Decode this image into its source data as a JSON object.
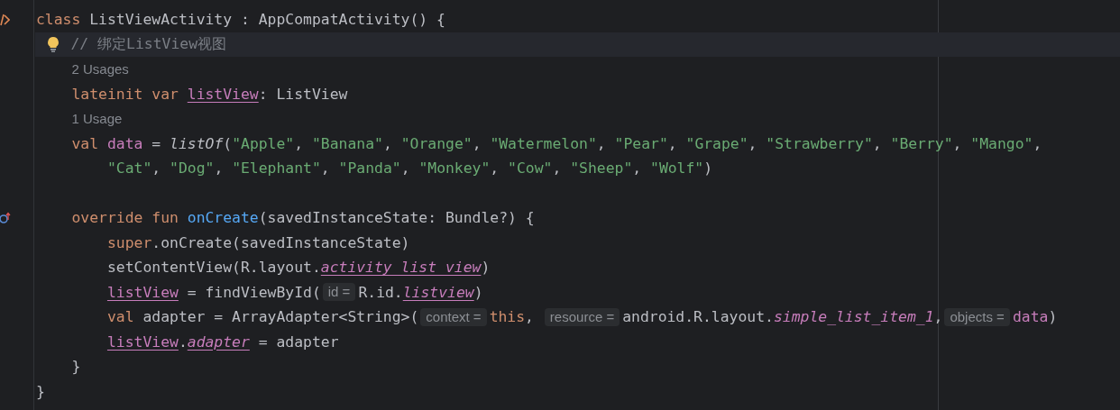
{
  "editor": {
    "lines": [
      {
        "class_marker": true,
        "tokens": [
          {
            "kind": "keyword",
            "text": "class"
          },
          {
            "kind": "text",
            "text": " ListViewActivity : AppCompatActivity() {"
          }
        ],
        "children": [
          {
            "current": true,
            "intention": true,
            "tokens": [
              {
                "kind": "comment",
                "text": "// 绑定ListView视图"
              }
            ]
          },
          {
            "tokens": [
              {
                "kind": "usage",
                "text": "2 Usages"
              }
            ]
          },
          {
            "tokens": [
              {
                "kind": "keyword",
                "text": "lateinit var "
              },
              {
                "kind": "prop-link",
                "text": "listView"
              },
              {
                "kind": "text",
                "text": ": ListView"
              }
            ]
          },
          {
            "tokens": [
              {
                "kind": "usage",
                "text": "1 Usage"
              }
            ]
          },
          {
            "tokens": [
              {
                "kind": "keyword",
                "text": "val "
              },
              {
                "kind": "prop",
                "text": "data"
              },
              {
                "kind": "text",
                "text": " = "
              },
              {
                "kind": "call",
                "text": "listOf"
              },
              {
                "kind": "text",
                "text": "("
              },
              {
                "kind": "string",
                "text": "\"Apple\""
              },
              {
                "kind": "text",
                "text": ", "
              },
              {
                "kind": "string",
                "text": "\"Banana\""
              },
              {
                "kind": "text",
                "text": ", "
              },
              {
                "kind": "string",
                "text": "\"Orange\""
              },
              {
                "kind": "text",
                "text": ", "
              },
              {
                "kind": "string",
                "text": "\"Watermelon\""
              },
              {
                "kind": "text",
                "text": ", "
              },
              {
                "kind": "string",
                "text": "\"Pear\""
              },
              {
                "kind": "text",
                "text": ", "
              },
              {
                "kind": "string",
                "text": "\"Grape\""
              },
              {
                "kind": "text",
                "text": ", "
              },
              {
                "kind": "string",
                "text": "\"Strawberry\""
              },
              {
                "kind": "text",
                "text": ", "
              },
              {
                "kind": "string",
                "text": "\"Berry\""
              },
              {
                "kind": "text",
                "text": ", "
              },
              {
                "kind": "string",
                "text": "\"Mango\""
              },
              {
                "kind": "text",
                "text": ","
              }
            ],
            "children": [
              {
                "tokens": [
                  {
                    "kind": "string",
                    "text": "\"Cat\""
                  },
                  {
                    "kind": "text",
                    "text": ", "
                  },
                  {
                    "kind": "string",
                    "text": "\"Dog\""
                  },
                  {
                    "kind": "text",
                    "text": ", "
                  },
                  {
                    "kind": "string",
                    "text": "\"Elephant\""
                  },
                  {
                    "kind": "text",
                    "text": ", "
                  },
                  {
                    "kind": "string",
                    "text": "\"Panda\""
                  },
                  {
                    "kind": "text",
                    "text": ", "
                  },
                  {
                    "kind": "string",
                    "text": "\"Monkey\""
                  },
                  {
                    "kind": "text",
                    "text": ", "
                  },
                  {
                    "kind": "string",
                    "text": "\"Cow\""
                  },
                  {
                    "kind": "text",
                    "text": ", "
                  },
                  {
                    "kind": "string",
                    "text": "\"Sheep\""
                  },
                  {
                    "kind": "text",
                    "text": ", "
                  },
                  {
                    "kind": "string",
                    "text": "\"Wolf\""
                  },
                  {
                    "kind": "text",
                    "text": ")"
                  }
                ]
              }
            ]
          },
          {
            "gap_before": true,
            "override_marker": true,
            "tokens": [
              {
                "kind": "keyword",
                "text": "override fun "
              },
              {
                "kind": "decl",
                "text": "onCreate"
              },
              {
                "kind": "text",
                "text": "(savedInstanceState: Bundle?) {"
              }
            ],
            "children": [
              {
                "tokens": [
                  {
                    "kind": "keyword",
                    "text": "super"
                  },
                  {
                    "kind": "text",
                    "text": ".onCreate(savedInstanceState)"
                  }
                ]
              },
              {
                "tokens": [
                  {
                    "kind": "text",
                    "text": "setContentView(R.layout."
                  },
                  {
                    "kind": "static-link",
                    "text": "activity_list_view"
                  },
                  {
                    "kind": "text",
                    "text": ")"
                  }
                ]
              },
              {
                "tokens": [
                  {
                    "kind": "prop-link",
                    "text": "listView"
                  },
                  {
                    "kind": "text",
                    "text": " = findViewById("
                  },
                  {
                    "kind": "hint",
                    "text": "id ="
                  },
                  {
                    "kind": "text",
                    "text": "R.id."
                  },
                  {
                    "kind": "static-link",
                    "text": "listview"
                  },
                  {
                    "kind": "text",
                    "text": ")"
                  }
                ]
              },
              {
                "tokens": [
                  {
                    "kind": "keyword",
                    "text": "val"
                  },
                  {
                    "kind": "text",
                    "text": " adapter = ArrayAdapter<String>("
                  },
                  {
                    "kind": "hint",
                    "text": "context ="
                  },
                  {
                    "kind": "keyword",
                    "text": "this"
                  },
                  {
                    "kind": "text",
                    "text": ", "
                  },
                  {
                    "kind": "hint",
                    "text": "resource ="
                  },
                  {
                    "kind": "text",
                    "text": "android.R.layout."
                  },
                  {
                    "kind": "static",
                    "text": "simple_list_item_1"
                  },
                  {
                    "kind": "text",
                    "text": ","
                  },
                  {
                    "kind": "hint",
                    "text": "objects ="
                  },
                  {
                    "kind": "prop",
                    "text": "data"
                  },
                  {
                    "kind": "text",
                    "text": ")"
                  }
                ]
              },
              {
                "tokens": [
                  {
                    "kind": "prop-link",
                    "text": "listView"
                  },
                  {
                    "kind": "text",
                    "text": "."
                  },
                  {
                    "kind": "static-link",
                    "text": "adapter"
                  },
                  {
                    "kind": "text",
                    "text": " = adapter"
                  }
                ]
              }
            ]
          },
          {
            "tokens": [
              {
                "kind": "text",
                "text": "}"
              }
            ]
          }
        ]
      },
      {
        "tokens": [
          {
            "kind": "text",
            "text": "}"
          }
        ]
      }
    ]
  }
}
